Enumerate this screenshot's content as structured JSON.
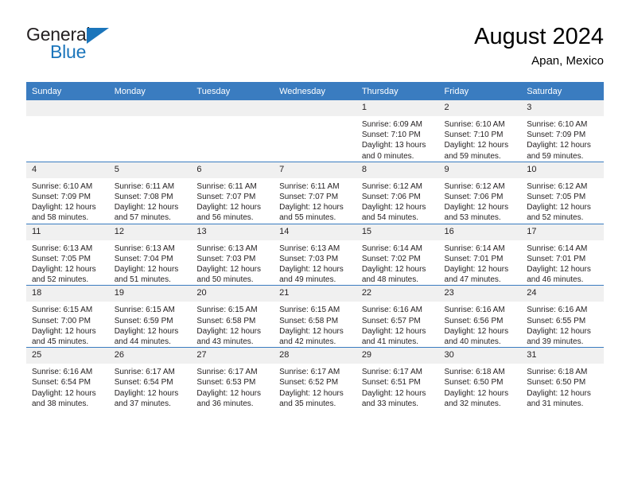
{
  "brand": {
    "name_part1": "General",
    "name_part2": "Blue",
    "accent_color": "#1b75bb"
  },
  "header": {
    "title": "August 2024",
    "subtitle": "Apan, Mexico"
  },
  "theme": {
    "header_row_color": "#3a7cc0",
    "daynum_band_color": "#f0f0f0",
    "text_color": "#231f20"
  },
  "weekday_headers": [
    "Sunday",
    "Monday",
    "Tuesday",
    "Wednesday",
    "Thursday",
    "Friday",
    "Saturday"
  ],
  "weeks": [
    [
      {
        "day": "",
        "empty": true,
        "sunrise": "",
        "sunset": "",
        "daylight_line1": "",
        "daylight_line2": ""
      },
      {
        "day": "",
        "empty": true,
        "sunrise": "",
        "sunset": "",
        "daylight_line1": "",
        "daylight_line2": ""
      },
      {
        "day": "",
        "empty": true,
        "sunrise": "",
        "sunset": "",
        "daylight_line1": "",
        "daylight_line2": ""
      },
      {
        "day": "",
        "empty": true,
        "sunrise": "",
        "sunset": "",
        "daylight_line1": "",
        "daylight_line2": ""
      },
      {
        "day": "1",
        "empty": false,
        "sunrise": "Sunrise: 6:09 AM",
        "sunset": "Sunset: 7:10 PM",
        "daylight_line1": "Daylight: 13 hours",
        "daylight_line2": "and 0 minutes."
      },
      {
        "day": "2",
        "empty": false,
        "sunrise": "Sunrise: 6:10 AM",
        "sunset": "Sunset: 7:10 PM",
        "daylight_line1": "Daylight: 12 hours",
        "daylight_line2": "and 59 minutes."
      },
      {
        "day": "3",
        "empty": false,
        "sunrise": "Sunrise: 6:10 AM",
        "sunset": "Sunset: 7:09 PM",
        "daylight_line1": "Daylight: 12 hours",
        "daylight_line2": "and 59 minutes."
      }
    ],
    [
      {
        "day": "4",
        "empty": false,
        "sunrise": "Sunrise: 6:10 AM",
        "sunset": "Sunset: 7:09 PM",
        "daylight_line1": "Daylight: 12 hours",
        "daylight_line2": "and 58 minutes."
      },
      {
        "day": "5",
        "empty": false,
        "sunrise": "Sunrise: 6:11 AM",
        "sunset": "Sunset: 7:08 PM",
        "daylight_line1": "Daylight: 12 hours",
        "daylight_line2": "and 57 minutes."
      },
      {
        "day": "6",
        "empty": false,
        "sunrise": "Sunrise: 6:11 AM",
        "sunset": "Sunset: 7:07 PM",
        "daylight_line1": "Daylight: 12 hours",
        "daylight_line2": "and 56 minutes."
      },
      {
        "day": "7",
        "empty": false,
        "sunrise": "Sunrise: 6:11 AM",
        "sunset": "Sunset: 7:07 PM",
        "daylight_line1": "Daylight: 12 hours",
        "daylight_line2": "and 55 minutes."
      },
      {
        "day": "8",
        "empty": false,
        "sunrise": "Sunrise: 6:12 AM",
        "sunset": "Sunset: 7:06 PM",
        "daylight_line1": "Daylight: 12 hours",
        "daylight_line2": "and 54 minutes."
      },
      {
        "day": "9",
        "empty": false,
        "sunrise": "Sunrise: 6:12 AM",
        "sunset": "Sunset: 7:06 PM",
        "daylight_line1": "Daylight: 12 hours",
        "daylight_line2": "and 53 minutes."
      },
      {
        "day": "10",
        "empty": false,
        "sunrise": "Sunrise: 6:12 AM",
        "sunset": "Sunset: 7:05 PM",
        "daylight_line1": "Daylight: 12 hours",
        "daylight_line2": "and 52 minutes."
      }
    ],
    [
      {
        "day": "11",
        "empty": false,
        "sunrise": "Sunrise: 6:13 AM",
        "sunset": "Sunset: 7:05 PM",
        "daylight_line1": "Daylight: 12 hours",
        "daylight_line2": "and 52 minutes."
      },
      {
        "day": "12",
        "empty": false,
        "sunrise": "Sunrise: 6:13 AM",
        "sunset": "Sunset: 7:04 PM",
        "daylight_line1": "Daylight: 12 hours",
        "daylight_line2": "and 51 minutes."
      },
      {
        "day": "13",
        "empty": false,
        "sunrise": "Sunrise: 6:13 AM",
        "sunset": "Sunset: 7:03 PM",
        "daylight_line1": "Daylight: 12 hours",
        "daylight_line2": "and 50 minutes."
      },
      {
        "day": "14",
        "empty": false,
        "sunrise": "Sunrise: 6:13 AM",
        "sunset": "Sunset: 7:03 PM",
        "daylight_line1": "Daylight: 12 hours",
        "daylight_line2": "and 49 minutes."
      },
      {
        "day": "15",
        "empty": false,
        "sunrise": "Sunrise: 6:14 AM",
        "sunset": "Sunset: 7:02 PM",
        "daylight_line1": "Daylight: 12 hours",
        "daylight_line2": "and 48 minutes."
      },
      {
        "day": "16",
        "empty": false,
        "sunrise": "Sunrise: 6:14 AM",
        "sunset": "Sunset: 7:01 PM",
        "daylight_line1": "Daylight: 12 hours",
        "daylight_line2": "and 47 minutes."
      },
      {
        "day": "17",
        "empty": false,
        "sunrise": "Sunrise: 6:14 AM",
        "sunset": "Sunset: 7:01 PM",
        "daylight_line1": "Daylight: 12 hours",
        "daylight_line2": "and 46 minutes."
      }
    ],
    [
      {
        "day": "18",
        "empty": false,
        "sunrise": "Sunrise: 6:15 AM",
        "sunset": "Sunset: 7:00 PM",
        "daylight_line1": "Daylight: 12 hours",
        "daylight_line2": "and 45 minutes."
      },
      {
        "day": "19",
        "empty": false,
        "sunrise": "Sunrise: 6:15 AM",
        "sunset": "Sunset: 6:59 PM",
        "daylight_line1": "Daylight: 12 hours",
        "daylight_line2": "and 44 minutes."
      },
      {
        "day": "20",
        "empty": false,
        "sunrise": "Sunrise: 6:15 AM",
        "sunset": "Sunset: 6:58 PM",
        "daylight_line1": "Daylight: 12 hours",
        "daylight_line2": "and 43 minutes."
      },
      {
        "day": "21",
        "empty": false,
        "sunrise": "Sunrise: 6:15 AM",
        "sunset": "Sunset: 6:58 PM",
        "daylight_line1": "Daylight: 12 hours",
        "daylight_line2": "and 42 minutes."
      },
      {
        "day": "22",
        "empty": false,
        "sunrise": "Sunrise: 6:16 AM",
        "sunset": "Sunset: 6:57 PM",
        "daylight_line1": "Daylight: 12 hours",
        "daylight_line2": "and 41 minutes."
      },
      {
        "day": "23",
        "empty": false,
        "sunrise": "Sunrise: 6:16 AM",
        "sunset": "Sunset: 6:56 PM",
        "daylight_line1": "Daylight: 12 hours",
        "daylight_line2": "and 40 minutes."
      },
      {
        "day": "24",
        "empty": false,
        "sunrise": "Sunrise: 6:16 AM",
        "sunset": "Sunset: 6:55 PM",
        "daylight_line1": "Daylight: 12 hours",
        "daylight_line2": "and 39 minutes."
      }
    ],
    [
      {
        "day": "25",
        "empty": false,
        "sunrise": "Sunrise: 6:16 AM",
        "sunset": "Sunset: 6:54 PM",
        "daylight_line1": "Daylight: 12 hours",
        "daylight_line2": "and 38 minutes."
      },
      {
        "day": "26",
        "empty": false,
        "sunrise": "Sunrise: 6:17 AM",
        "sunset": "Sunset: 6:54 PM",
        "daylight_line1": "Daylight: 12 hours",
        "daylight_line2": "and 37 minutes."
      },
      {
        "day": "27",
        "empty": false,
        "sunrise": "Sunrise: 6:17 AM",
        "sunset": "Sunset: 6:53 PM",
        "daylight_line1": "Daylight: 12 hours",
        "daylight_line2": "and 36 minutes."
      },
      {
        "day": "28",
        "empty": false,
        "sunrise": "Sunrise: 6:17 AM",
        "sunset": "Sunset: 6:52 PM",
        "daylight_line1": "Daylight: 12 hours",
        "daylight_line2": "and 35 minutes."
      },
      {
        "day": "29",
        "empty": false,
        "sunrise": "Sunrise: 6:17 AM",
        "sunset": "Sunset: 6:51 PM",
        "daylight_line1": "Daylight: 12 hours",
        "daylight_line2": "and 33 minutes."
      },
      {
        "day": "30",
        "empty": false,
        "sunrise": "Sunrise: 6:18 AM",
        "sunset": "Sunset: 6:50 PM",
        "daylight_line1": "Daylight: 12 hours",
        "daylight_line2": "and 32 minutes."
      },
      {
        "day": "31",
        "empty": false,
        "sunrise": "Sunrise: 6:18 AM",
        "sunset": "Sunset: 6:50 PM",
        "daylight_line1": "Daylight: 12 hours",
        "daylight_line2": "and 31 minutes."
      }
    ]
  ]
}
